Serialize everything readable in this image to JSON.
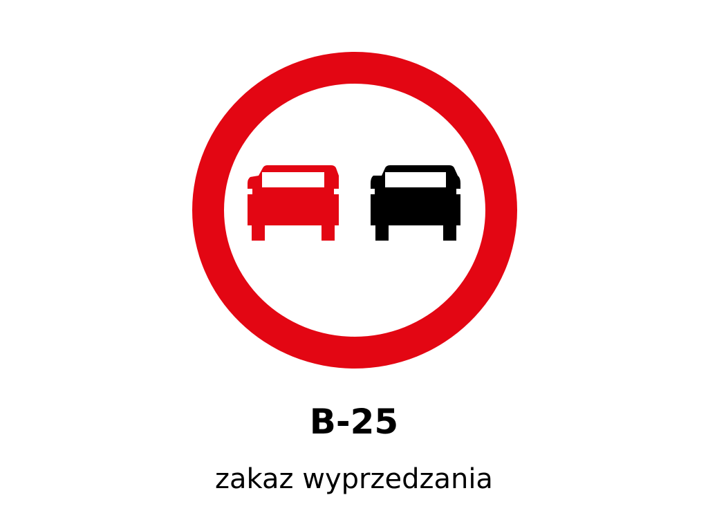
{
  "sign": {
    "code": "B-25",
    "description": "zakaz wyprzedzania",
    "colors": {
      "ring": "#e30613",
      "background": "#ffffff",
      "left_car": "#e30613",
      "right_car": "#000000"
    },
    "icons": {
      "left_car": "car-front-icon",
      "right_car": "car-front-icon"
    }
  }
}
